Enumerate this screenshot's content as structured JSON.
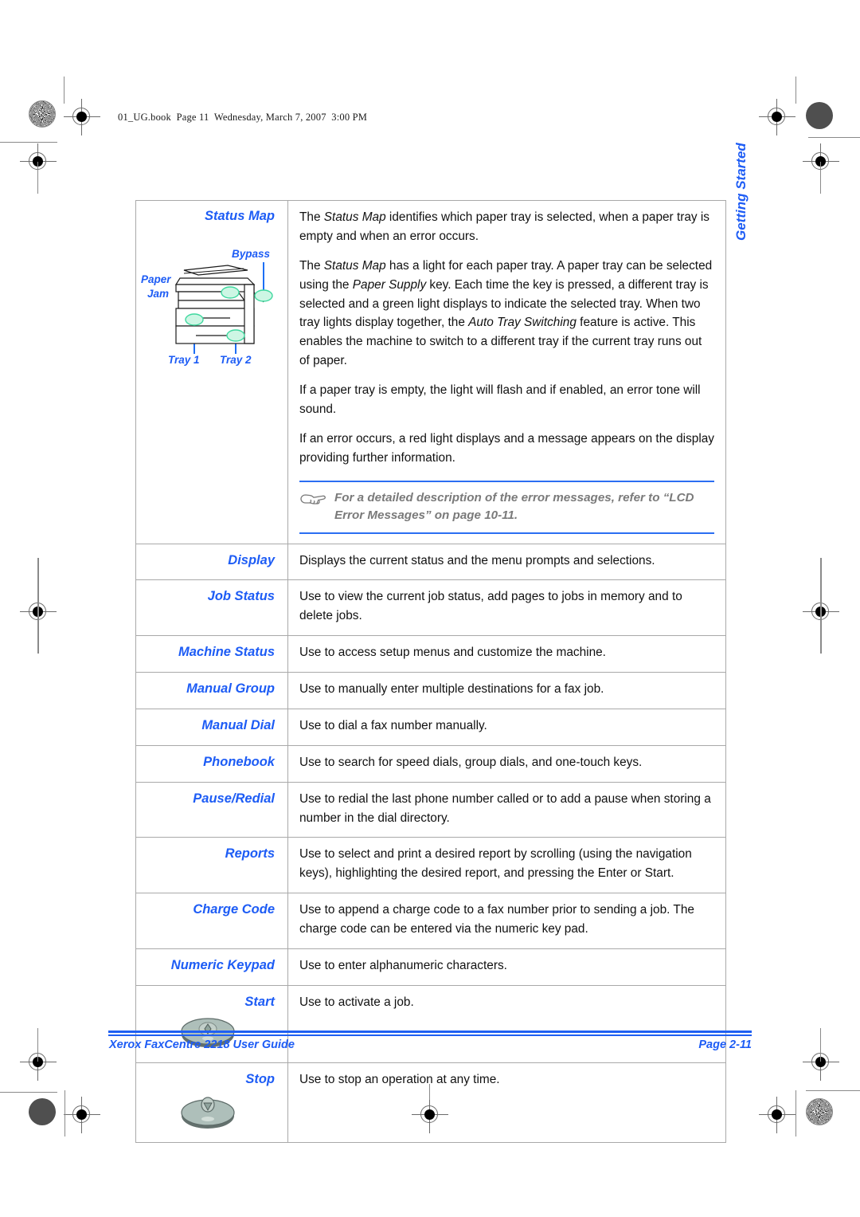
{
  "page": {
    "header_slug": "01_UG.book  Page 11  Wednesday, March 7, 2007  3:00 PM",
    "side_tab": "Getting Started"
  },
  "footer": {
    "left": "Xerox FaxCentre 2218 User Guide",
    "right": "Page 2-11"
  },
  "status_map": {
    "label": "Status Map",
    "diagram": {
      "bypass": "Bypass",
      "paper": "Paper",
      "jam": "Jam",
      "tray1": "Tray 1",
      "tray2": "Tray 2"
    },
    "paragraphs": [
      {
        "parts": [
          {
            "text": "The ",
            "italic": false
          },
          {
            "text": "Status Map",
            "italic": true
          },
          {
            "text": " identifies which paper tray is selected, when a paper tray is empty and when an error occurs.",
            "italic": false
          }
        ]
      },
      {
        "parts": [
          {
            "text": "The ",
            "italic": false
          },
          {
            "text": "Status Map",
            "italic": true
          },
          {
            "text": " has a light for each paper tray. A paper tray can be selected using the ",
            "italic": false
          },
          {
            "text": "Paper Supply",
            "italic": true
          },
          {
            "text": " key. Each time the key is pressed, a different tray is selected and a green light displays to indicate the selected tray. When two tray lights display together, the ",
            "italic": false
          },
          {
            "text": "Auto Tray Switching",
            "italic": true
          },
          {
            "text": " feature is active. This enables the machine to switch to a different tray if the current tray runs out of paper.",
            "italic": false
          }
        ]
      },
      {
        "parts": [
          {
            "text": "If a paper tray is empty, the light will flash and if enabled, an error tone will sound.",
            "italic": false
          }
        ]
      },
      {
        "parts": [
          {
            "text": "If an error occurs, a red light displays and a message appears on the display providing further information.",
            "italic": false
          }
        ]
      }
    ],
    "note": {
      "icon": "pointing-hand-icon",
      "text": "For a detailed description of the error messages, refer to “LCD Error Messages” on page 10-11."
    }
  },
  "rows": [
    {
      "label": "Display",
      "description": "Displays the current status and the menu prompts and selections.",
      "button": null
    },
    {
      "label": "Job Status",
      "description": "Use to view the current job status, add pages to jobs in memory and to delete jobs.",
      "button": null
    },
    {
      "label": "Machine Status",
      "description": "Use to access setup menus and customize the machine.",
      "button": null
    },
    {
      "label": "Manual Group",
      "description": "Use to manually enter multiple destinations for a fax job.",
      "button": null
    },
    {
      "label": "Manual Dial",
      "description": "Use to dial a fax number manually.",
      "button": null
    },
    {
      "label": "Phonebook",
      "description": "Use to search for speed dials, group dials, and one-touch keys.",
      "button": null
    },
    {
      "label": "Pause/Redial",
      "description": "Use to redial the last phone number called or to add a pause when storing a number in the dial directory.",
      "button": null
    },
    {
      "label": "Reports",
      "description": "Use to select and print a desired report by scrolling (using the navigation keys), highlighting the desired report, and pressing the Enter or Start.",
      "button": null
    },
    {
      "label": "Charge Code",
      "description": "Use to append a charge code to a fax number prior to sending a job. The charge code can be entered via the numeric key pad.",
      "button": null
    },
    {
      "label": "Numeric Keypad",
      "description": "Use to enter alphanumeric characters.",
      "button": null
    },
    {
      "label": "Start",
      "description": "Use to activate a job.",
      "button": "start-button-illustration"
    },
    {
      "label": "Stop",
      "description": "Use to stop an operation at any time.",
      "button": "stop-button-illustration"
    }
  ],
  "colors": {
    "accent_blue": "#1d5cf5",
    "rule_blue": "#1f5ff2",
    "note_gray": "#7a7a7a",
    "table_border": "#a9a9a9",
    "indicator_green": "#4de0a8"
  }
}
